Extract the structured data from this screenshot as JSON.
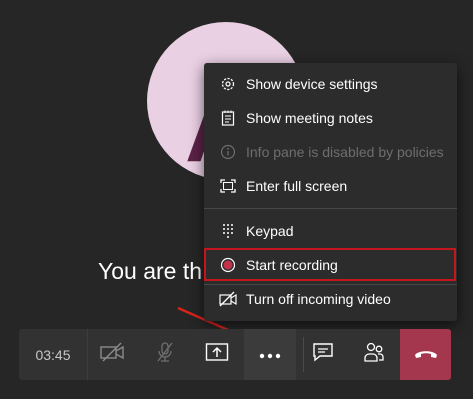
{
  "avatar": {
    "initial": "A",
    "color": "#e9d0e3"
  },
  "stage": {
    "status_text": "You are th"
  },
  "menu": {
    "items": [
      {
        "label": "Show device settings",
        "icon": "gear-icon",
        "disabled": false
      },
      {
        "label": "Show meeting notes",
        "icon": "notes-icon",
        "disabled": false
      },
      {
        "label": "Info pane is disabled by policies",
        "icon": "info-icon",
        "disabled": true
      },
      {
        "label": "Enter full screen",
        "icon": "fullscreen-icon",
        "disabled": false
      },
      {
        "label": "Keypad",
        "icon": "keypad-icon",
        "disabled": false
      },
      {
        "label": "Start recording",
        "icon": "record-icon",
        "disabled": false,
        "highlighted": true
      },
      {
        "label": "Turn off incoming video",
        "icon": "video-off-icon",
        "disabled": false
      }
    ]
  },
  "toolbar": {
    "timer": "03:45",
    "buttons": [
      "camera-off-icon",
      "mic-off-icon",
      "share-screen-icon",
      "more-actions-icon",
      "chat-icon",
      "participants-icon",
      "hang-up-icon"
    ]
  },
  "colors": {
    "highlight": "#c4161c",
    "hangup": "#a4374d",
    "record": "#c4314b"
  }
}
